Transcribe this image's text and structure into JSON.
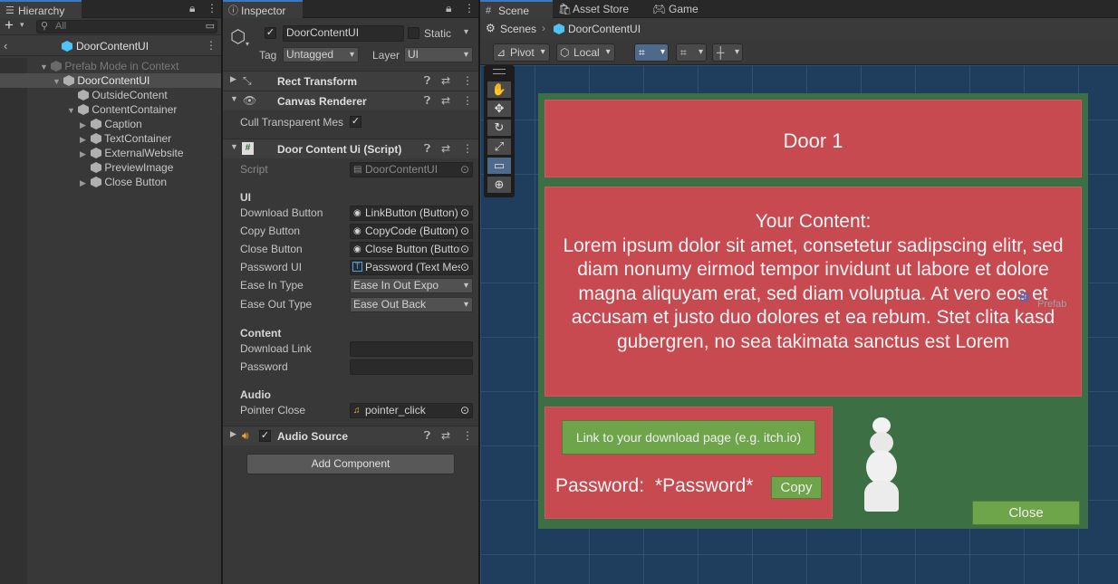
{
  "hierarchy": {
    "tab": "Hierarchy",
    "add_label": "+",
    "search_placeholder": "All",
    "prefab_title": "DoorContentUI",
    "rows": [
      {
        "label": "Prefab Mode in Context",
        "indent": 1,
        "arrow": "down",
        "icon": "grey-cube",
        "dim": true
      },
      {
        "label": "DoorContentUI",
        "indent": 2,
        "arrow": "down",
        "icon": "prefab-cube",
        "selected": true
      },
      {
        "label": "OutsideContent",
        "indent": 3,
        "arrow": "",
        "icon": "cube"
      },
      {
        "label": "ContentContainer",
        "indent": 3,
        "arrow": "down",
        "icon": "cube"
      },
      {
        "label": "Caption",
        "indent": 4,
        "arrow": "right",
        "icon": "cube"
      },
      {
        "label": "TextContainer",
        "indent": 4,
        "arrow": "right",
        "icon": "cube"
      },
      {
        "label": "ExternalWebsite",
        "indent": 4,
        "arrow": "right",
        "icon": "cube"
      },
      {
        "label": "PreviewImage",
        "indent": 4,
        "arrow": "",
        "icon": "cube"
      },
      {
        "label": "Close Button",
        "indent": 4,
        "arrow": "right",
        "icon": "cube"
      }
    ]
  },
  "inspector": {
    "tab": "Inspector",
    "object_name": "DoorContentUI",
    "static_label": "Static",
    "tag_label": "Tag",
    "tag_value": "Untagged",
    "layer_label": "Layer",
    "layer_value": "UI",
    "components": {
      "rect_transform": "Rect Transform",
      "canvas_renderer": "Canvas Renderer",
      "cull_label": "Cull Transparent Mes",
      "script_component": "Door Content Ui (Script)",
      "audio_source": "Audio Source"
    },
    "script_label": "Script",
    "script_value": "DoorContentUI",
    "ui_section": "UI",
    "ui_fields": [
      {
        "label": "Download Button",
        "value": "LinkButton (Button)",
        "icon": "◉"
      },
      {
        "label": "Copy Button",
        "value": "CopyCode (Button)",
        "icon": "◉"
      },
      {
        "label": "Close Button",
        "value": "Close Button (Button)",
        "icon": "◉"
      },
      {
        "label": "Password UI",
        "value": "Password (Text Mesh Pro)",
        "icon": "T"
      }
    ],
    "ease_in_label": "Ease In Type",
    "ease_in_value": "Ease In Out Expo",
    "ease_out_label": "Ease Out Type",
    "ease_out_value": "Ease Out Back",
    "content_section": "Content",
    "download_link_label": "Download Link",
    "download_link_value": "",
    "password_label": "Password",
    "password_value": "",
    "audio_section": "Audio",
    "pointer_close_label": "Pointer Close",
    "pointer_close_value": "pointer_click",
    "add_component": "Add Component"
  },
  "scene": {
    "tabs": [
      "Scene",
      "Asset Store",
      "Game"
    ],
    "breadcrumb_root": "Scenes",
    "breadcrumb_current": "DoorContentUI",
    "pivot": "Pivot",
    "local": "Local",
    "tools": [
      "✋",
      "✥",
      "↻",
      "⤢",
      "▭",
      "⊕"
    ],
    "ui": {
      "caption": "Door 1",
      "content_heading": "Your Content:",
      "content_body": "Lorem ipsum dolor sit amet, consetetur sadipscing elitr, sed diam nonumy eirmod tempor invidunt ut labore et dolore magna aliquyam erat, sed diam voluptua. At vero eos et accusam et justo duo dolores et ea rebum. Stet clita kasd gubergren, no sea takimata sanctus est Lorem",
      "link_button": "Link to your download page (e.g. itch.io)",
      "password_label": "Password:",
      "password_value": "*Password*",
      "copy_button": "Copy",
      "close_button": "Close",
      "prefab_tag": "Prefab"
    }
  }
}
